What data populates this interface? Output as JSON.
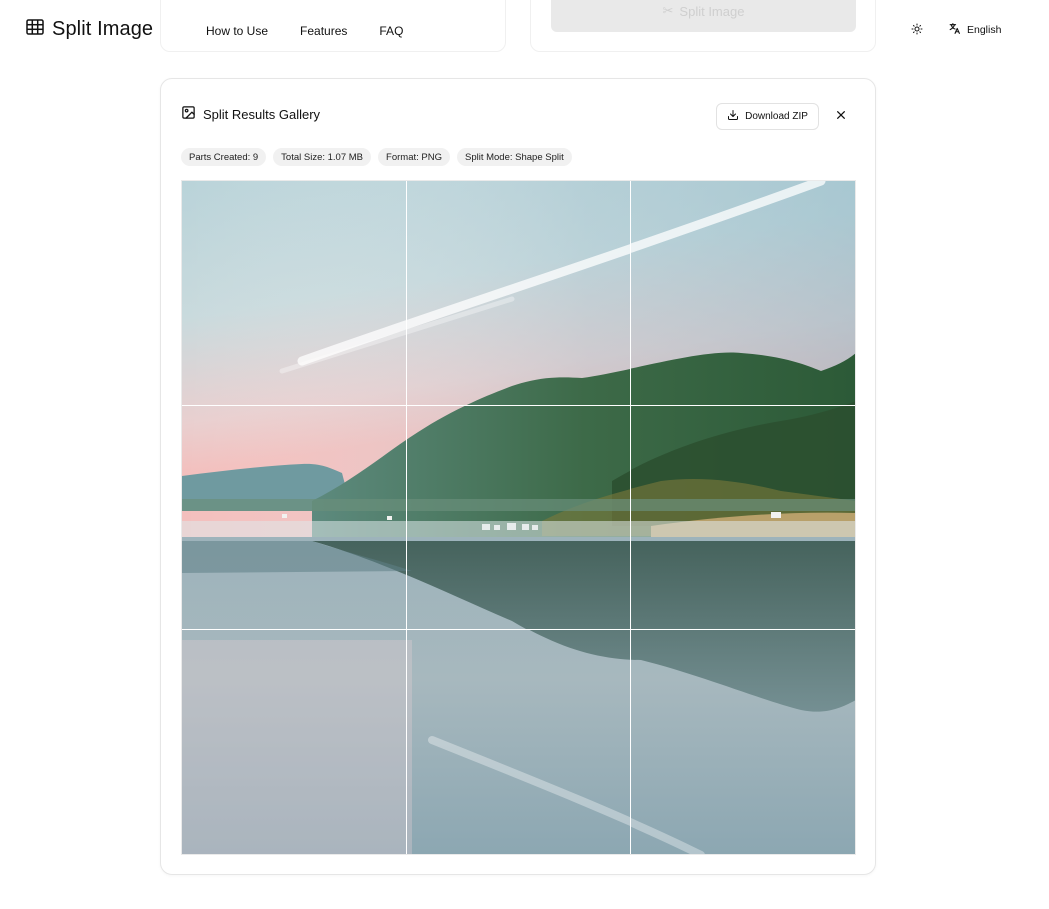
{
  "app": {
    "name": "Split Image",
    "background_button_label": "Split Image"
  },
  "nav": {
    "items": [
      "How to Use",
      "Features",
      "FAQ"
    ]
  },
  "header": {
    "language": "English",
    "theme_icon": "sun-icon",
    "language_icon": "translate-icon"
  },
  "gallery": {
    "title": "Split Results Gallery",
    "download_label": "Download ZIP",
    "stats": {
      "parts": "Parts Created: 9",
      "size": "Total Size: 1.07 MB",
      "format": "Format: PNG",
      "mode": "Split Mode: Shape Split"
    },
    "grid": {
      "rows": 3,
      "cols": 3
    }
  },
  "colors": {
    "sky_top": "#a9c9d1",
    "sky_pink": "#f1c4c2",
    "mountain_green": "#3f6b4a",
    "water": "#8aa9b4"
  }
}
